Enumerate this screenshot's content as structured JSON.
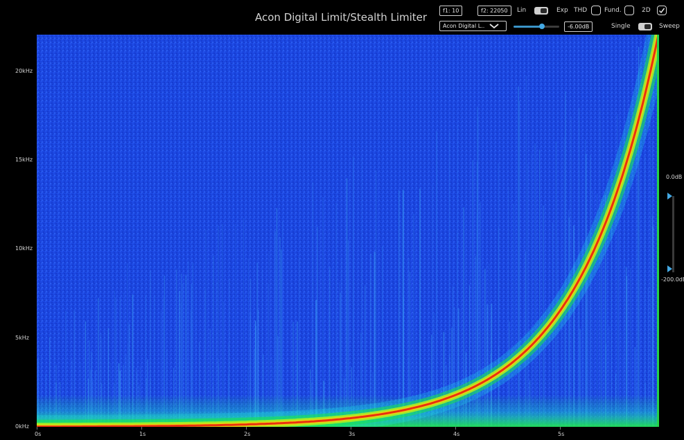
{
  "header": {
    "title": "Acon Digital Limit/Stealth Limiter",
    "f1_label": "f1: 10",
    "f2_label": "f2: 22050",
    "plugin_select": "Acon Digital L..",
    "lin_label": "Lin",
    "exp_label": "Exp",
    "thd_label": "THD",
    "fund_label": "Fund.",
    "twod_label": "2D",
    "gain_value": "-6.00dB",
    "single_label": "Single",
    "sweep_label": "Sweep"
  },
  "state": {
    "lin_exp_toggle": "Exp",
    "thd_checked": false,
    "fund_checked": false,
    "twod_checked": true,
    "single_sweep_toggle": "Sweep",
    "gain_slider_fraction": 0.62
  },
  "colors": {
    "background": "#1b46e0",
    "sweep_core": "#e83010",
    "sweep_halo": "#18e64a",
    "accent": "#44a9e4"
  },
  "chart_data": {
    "type": "heatmap",
    "title": "Acon Digital Limit/Stealth Limiter",
    "xlabel": "",
    "ylabel": "",
    "x_ticks": [
      "0s",
      "1s",
      "2s",
      "3s",
      "4s",
      "5s"
    ],
    "y_ticks": [
      "0kHz",
      "5kHz",
      "10kHz",
      "15kHz",
      "20kHz"
    ],
    "xlim": [
      0,
      5.94
    ],
    "ylim_hz": [
      0,
      22050
    ],
    "color_scale_labels": [
      "0.0dB",
      "-200.0dB"
    ],
    "sweep": {
      "type": "exponential",
      "start_hz": 10,
      "end_hz": 22050,
      "duration_s": 5.94
    }
  }
}
